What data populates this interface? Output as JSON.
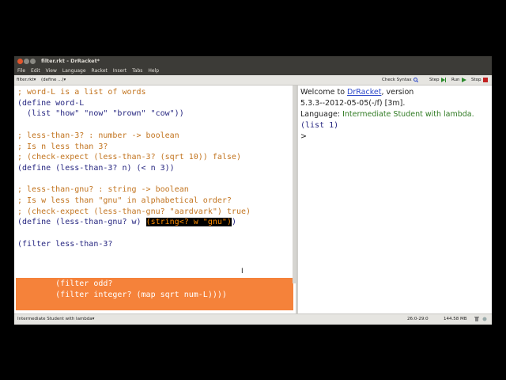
{
  "window": {
    "title": "filter.rkt - DrRacket*"
  },
  "menu": [
    "File",
    "Edit",
    "View",
    "Language",
    "Racket",
    "Insert",
    "Tabs",
    "Help"
  ],
  "toolbar": {
    "file_dropdown": "filter.rkt▾",
    "define_dropdown": "(define ...)▾",
    "check_syntax": "Check Syntax",
    "step": "Step",
    "run": "Run",
    "stop": "Stop"
  },
  "editor": {
    "lines": [
      "; word-L is a list of words",
      "(define word-L",
      "  (list \"how\" \"now\" \"brown\" \"cow\"))",
      "",
      "; less-than-3? : number -> boolean",
      "; Is n less than 3?",
      "; (check-expect (less-than-3? (sqrt 10)) false)",
      "(define (less-than-3? n) (< n 3))",
      "",
      "; less-than-gnu? : string -> boolean",
      "; Is w less than \"gnu\" in alphabetical order?",
      "; (check-expect (less-than-gnu? \"aardvark\") true)",
      "(define (less-than-gnu? w) ",
      "(string<? w \"gnu\")",
      ")",
      "",
      "(filter less-than-3?",
      "        (filter odd?",
      "        (filter integer? (map sqrt num-L))))"
    ]
  },
  "interactions": {
    "welcome": "Welcome to ",
    "link": "DrRacket",
    "version_suffix": ", version",
    "version": "5.3.3--2012-05-05(-/f) [3m].",
    "language_label": "Language: ",
    "language": "Intermediate Student with lambda.",
    "result": "(list 1)",
    "prompt": ">"
  },
  "status": {
    "language": "Intermediate Student with lambda▾",
    "position": "26:0-29:0",
    "memory": "144.58 MB"
  }
}
